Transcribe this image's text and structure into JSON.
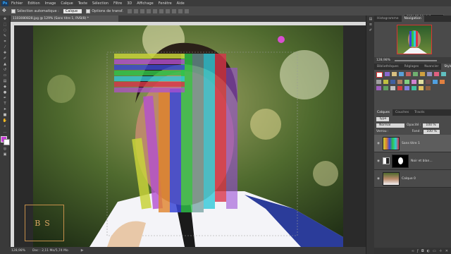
{
  "menubar": {
    "logo": "Ps",
    "items": [
      "Fichier",
      "Edition",
      "Image",
      "Calque",
      "Texte",
      "Sélection",
      "Filtre",
      "3D",
      "Affichage",
      "Fenêtre",
      "Aide"
    ]
  },
  "options": {
    "auto_select_label": "Sélection automatique :",
    "auto_select_value": "Calque",
    "transform_label": "Options de transf."
  },
  "workspace": {
    "label": "ESPACE BRUNO"
  },
  "document": {
    "tab_title": "1103080828.jpg @ 129% (Sans titre 1, RVB/8) *"
  },
  "status": {
    "zoom": "128,98%",
    "doc": "Doc : 2,11 Mo/5,74 Mo"
  },
  "panels": {
    "top_tabs": [
      "Histogramme",
      "Navigation"
    ],
    "zoom": "128,98%",
    "lib_tabs": [
      "Bibliothèques",
      "Réglages",
      "Nuancier",
      "Styles"
    ],
    "layer_tabs": [
      "Calques",
      "Couches",
      "Tracés"
    ],
    "filter_label": "Type",
    "blend_mode": "Normal",
    "opacity_label": "Opacité :",
    "opacity_value": "100 %",
    "lock_label": "Verrou :",
    "fill_label": "Fond :",
    "fill_value": "100 %",
    "layers": [
      {
        "name": "Sans titre 1"
      },
      {
        "name": "Noir et blan..."
      },
      {
        "name": "Calque 0"
      }
    ]
  },
  "watermark": {
    "text": "BS"
  },
  "colors": {
    "accent": "#31a8ff",
    "watermark": "#c48f4a"
  }
}
